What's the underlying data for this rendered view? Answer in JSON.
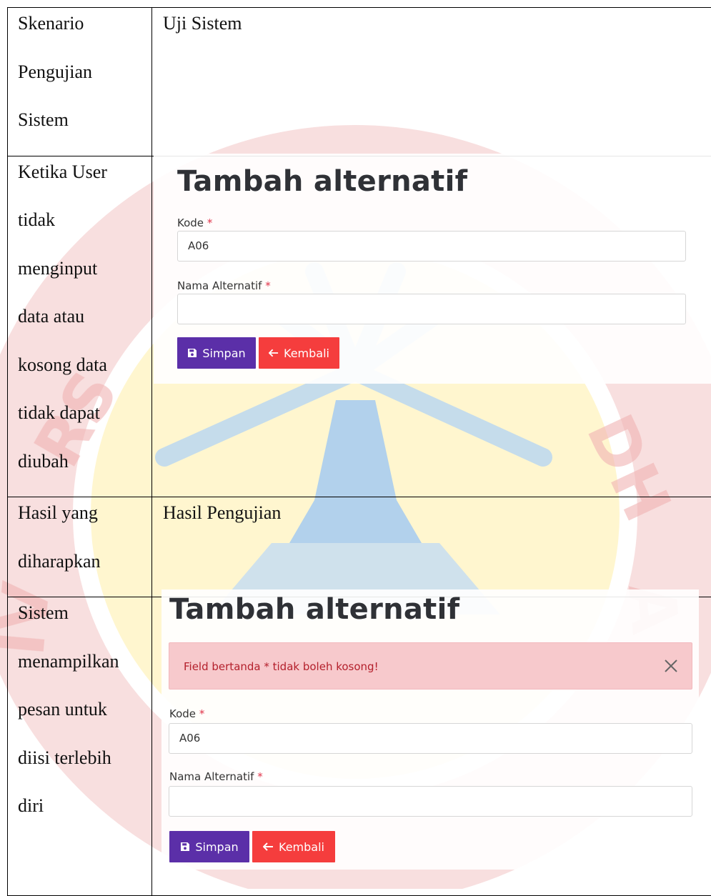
{
  "colors": {
    "watermark_red": "#f0b8b8",
    "watermark_yellow": "#fff2b5",
    "watermark_blue": "#b9d7f0",
    "button_save": "#5b2fa8",
    "button_back": "#f53d3d",
    "alert_bg": "#f7c9cc",
    "alert_text": "#b4202c",
    "required_star": "#e0344a"
  },
  "rows": {
    "scenario": {
      "left": [
        "Skenario",
        "Pengujian",
        "Sistem"
      ],
      "right": "Uji Sistem"
    },
    "input_case": {
      "left": [
        "Ketika User",
        "tidak",
        "menginput",
        "data atau",
        "kosong data",
        "tidak dapat",
        "diubah"
      ]
    },
    "expected": {
      "left": [
        "Hasil yang",
        "diharapkan"
      ],
      "right": "Hasil Pengujian"
    },
    "result": {
      "left": [
        "Sistem",
        "menampilkan",
        "pesan untuk",
        "diisi terlebih",
        "diri"
      ]
    }
  },
  "form1": {
    "title": "Tambah alternatif",
    "kode_label": "Kode",
    "kode_value": "A06",
    "nama_label": "Nama Alternatif",
    "nama_value": "",
    "required_mark": "*",
    "save_label": "Simpan",
    "back_label": "Kembali",
    "save_icon": "floppy-disk-icon",
    "back_icon": "arrow-left-icon"
  },
  "form2": {
    "title": "Tambah alternatif",
    "alert_text": "Field bertanda * tidak boleh kosong!",
    "alert_close_icon": "close-icon",
    "kode_label": "Kode",
    "kode_value": "A06",
    "nama_label": "Nama Alternatif",
    "nama_value": "",
    "required_mark": "*",
    "save_label": "Simpan",
    "back_label": "Kembali"
  }
}
